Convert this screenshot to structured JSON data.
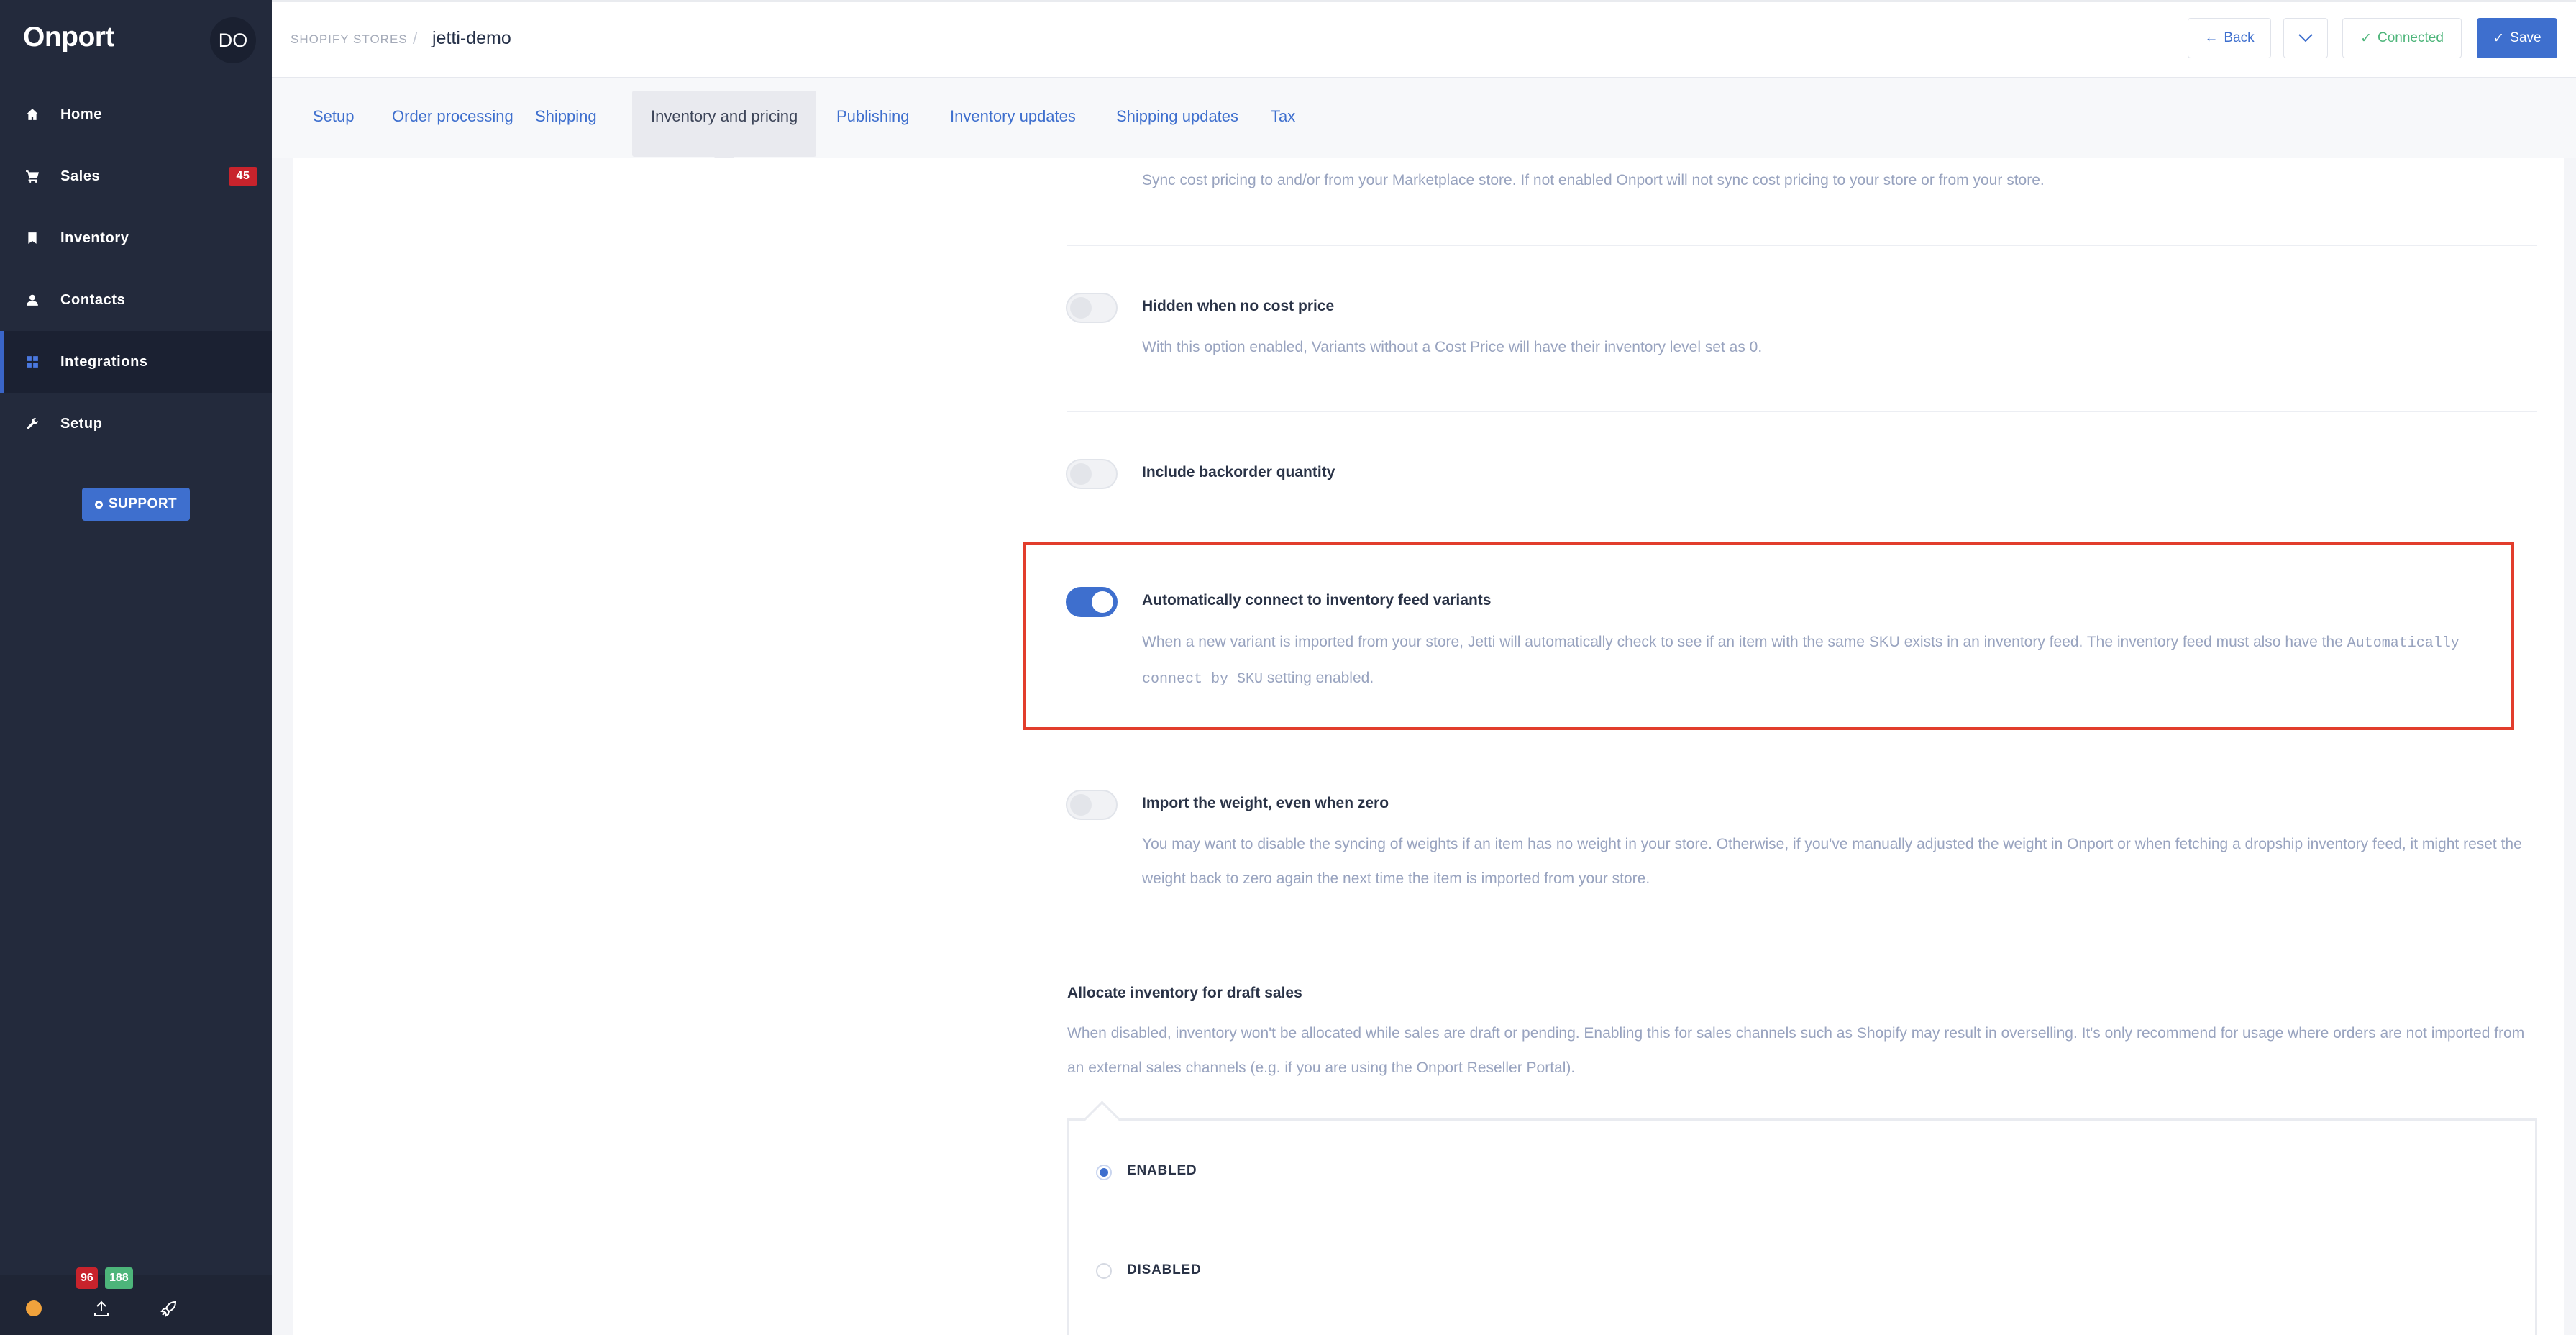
{
  "sidebar": {
    "logo": "Onport",
    "avatar_initials": "DO",
    "items": [
      {
        "label": "Home",
        "icon": "home-icon"
      },
      {
        "label": "Sales",
        "icon": "cart-icon",
        "badge": "45"
      },
      {
        "label": "Inventory",
        "icon": "bookmark-icon"
      },
      {
        "label": "Contacts",
        "icon": "user-icon"
      },
      {
        "label": "Integrations",
        "icon": "grid-icon",
        "active": true
      },
      {
        "label": "Setup",
        "icon": "wrench-icon"
      }
    ],
    "support_label": "SUPPORT",
    "footer": {
      "badge_red": "96",
      "badge_green": "188"
    }
  },
  "header": {
    "breadcrumb_parent": "SHOPIFY STORES",
    "breadcrumb_sep": "/",
    "title": "jetti-demo",
    "back_label": "Back",
    "connected_label": "Connected",
    "save_label": "Save"
  },
  "tabs": [
    {
      "label": "Setup"
    },
    {
      "label": "Order processing"
    },
    {
      "label": "Shipping"
    },
    {
      "label": "Inventory and pricing",
      "active": true
    },
    {
      "label": "Publishing"
    },
    {
      "label": "Inventory updates"
    },
    {
      "label": "Shipping updates"
    },
    {
      "label": "Tax"
    }
  ],
  "settings": {
    "cost_pricing_desc": "Sync cost pricing to and/or from your Marketplace store. If not enabled Onport will not sync cost pricing to your store or from your store.",
    "hidden_no_cost": {
      "label": "Hidden when no cost price",
      "desc": "With this option enabled, Variants without a Cost Price will have their inventory level set as 0.",
      "enabled": false
    },
    "include_backorder": {
      "label": "Include backorder quantity",
      "enabled": false
    },
    "auto_connect": {
      "label": "Automatically connect to inventory feed variants",
      "desc_pre": "When a new variant is imported from your store, Jetti will automatically check to see if an item with the same SKU exists in an inventory feed. The inventory feed must also have the",
      "desc_code": "Automatically connect by SKU",
      "desc_post": "setting enabled.",
      "enabled": true
    },
    "import_weight": {
      "label": "Import the weight, even when zero",
      "desc": "You may want to disable the syncing of weights if an item has no weight in your store. Otherwise, if you've manually adjusted the weight in Onport or when fetching a dropship inventory feed, it might reset the weight back to zero again the next time the item is imported from your store.",
      "enabled": false
    },
    "allocate_draft": {
      "heading": "Allocate inventory for draft sales",
      "desc": "When disabled, inventory won't be allocated while sales are draft or pending. Enabling this for sales channels such as Shopify may result in overselling. It's only recommend for usage where orders are not imported from an external sales channels (e.g. if you are using the Onport Reseller Portal).",
      "options": [
        {
          "label": "ENABLED",
          "selected": true
        },
        {
          "label": "DISABLED",
          "selected": false
        }
      ]
    }
  },
  "colors": {
    "accent": "#3e6fce",
    "sidebar_bg": "#232a3c",
    "highlight": "#e23d2c",
    "badge_red": "#c8232c",
    "badge_green": "#4db57a"
  }
}
